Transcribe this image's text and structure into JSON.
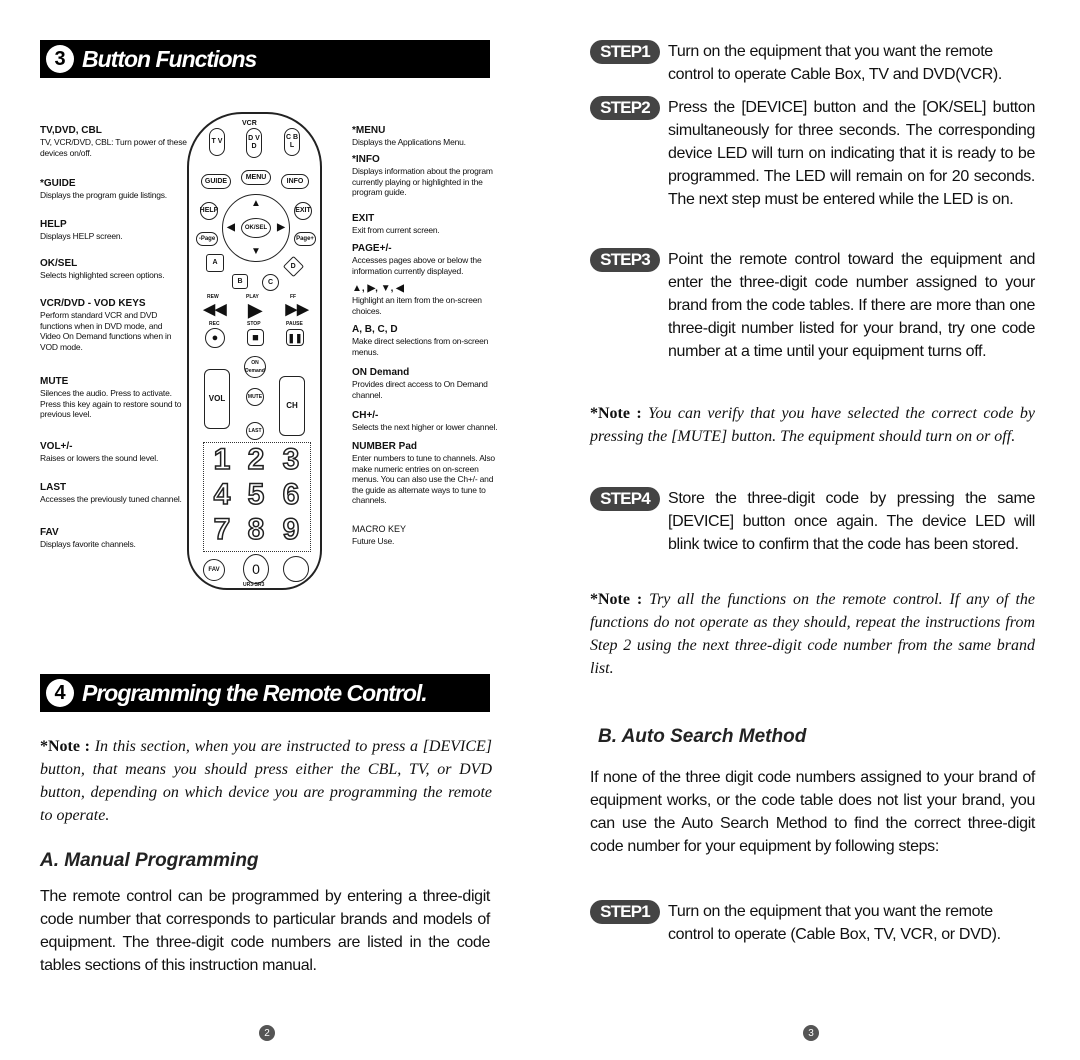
{
  "section3": {
    "number": "3",
    "title": "Button Functions"
  },
  "left_labels": [
    {
      "title": "TV,DVD, CBL",
      "desc": "TV, VCR/DVD, CBL: Turn power of these devices on/off."
    },
    {
      "title": "*GUIDE",
      "desc": "Displays the program guide listings."
    },
    {
      "title": "HELP",
      "desc": "Displays HELP screen."
    },
    {
      "title": "OK/SEL",
      "desc": "Selects highlighted screen options."
    },
    {
      "title": "VCR/DVD - VOD KEYS",
      "desc": "Perform standard VCR and DVD functions when in DVD mode, and Video On Demand functions when in VOD mode."
    },
    {
      "title": "MUTE",
      "desc": "Silences the audio. Press to activate. Press this key again to restore sound to previous level."
    },
    {
      "title": "VOL+/-",
      "desc": "Raises or lowers the sound level."
    },
    {
      "title": "LAST",
      "desc": "Accesses the previously tuned channel."
    },
    {
      "title": "FAV",
      "desc": "Displays favorite channels."
    }
  ],
  "right_labels": [
    {
      "title": "*MENU",
      "desc": "Displays the Applications Menu."
    },
    {
      "title": "*INFO",
      "desc": "Displays information about the program currently playing or highlighted in the program guide."
    },
    {
      "title": "EXIT",
      "desc": "Exit from current screen."
    },
    {
      "title": "PAGE+/-",
      "desc": "Accesses pages above or below the information currently displayed."
    },
    {
      "title": "▲, ▶, ▼, ◀",
      "desc": "Highlight an item from the on-screen choices."
    },
    {
      "title": "A, B, C, D",
      "desc": "Make direct selections from on-screen menus."
    },
    {
      "title": "ON Demand",
      "desc": "Provides direct access to On Demand channel."
    },
    {
      "title": "CH+/-",
      "desc": "Selects the next higher or lower channel."
    },
    {
      "title": "NUMBER Pad",
      "desc": "Enter numbers to tune to channels. Also make numeric entries on on-screen menus. You can also use the Ch+/- and the guide as alternate ways to tune to channels."
    },
    {
      "title": "MACRO KEY",
      "desc": "Future Use."
    }
  ],
  "remote": {
    "vcr": "VCR",
    "tv": "T V",
    "dvd": "D V D",
    "cbl": "C B L",
    "guide": "GUIDE",
    "menu": "MENU",
    "info": "INFO",
    "help": "HELP",
    "exit": "EXIT",
    "ok": "OK/SEL",
    "page_minus": "-Page",
    "page_plus": "Page+",
    "a": "A",
    "b": "B",
    "c": "C",
    "d": "D",
    "rew": "REW",
    "play": "PLAY",
    "ff": "FF",
    "rec": "REC",
    "stop": "STOP",
    "pause": "PAUSE",
    "on_demand": "ON Demand",
    "vol": "VOL",
    "mute": "MUTE",
    "ch": "CH",
    "last": "LAST",
    "fav": "FAV",
    "digits": [
      "1",
      "2",
      "3",
      "4",
      "5",
      "6",
      "7",
      "8",
      "9",
      "0"
    ],
    "model": "UR3-SR3"
  },
  "section4": {
    "number": "4",
    "title": "Programming the Remote Control."
  },
  "note_device": {
    "lead": "*Note :",
    "text": "In this section, when you are instructed to press a [DEVICE] button, that means you should press either the CBL, TV, or DVD button, depending on which device you are programming the remote to operate."
  },
  "manual": {
    "title": "A. Manual Programming",
    "text": "The remote control can be programmed by entering a three-digit code number that corresponds to particular brands and models of equipment. The three-digit code numbers are listed in the code tables sections of this instruction manual."
  },
  "steps": [
    {
      "badge": "STEP1",
      "text": "Turn on the equipment that you want the remote control to operate Cable Box, TV and DVD(VCR)."
    },
    {
      "badge": "STEP2",
      "text": "Press the [DEVICE] button and the [OK/SEL] button simultaneously for three seconds. The corresponding device LED will turn on indicating that it is ready to be programmed. The LED will remain on for 20 seconds. The next step must be entered while the LED is on."
    },
    {
      "badge": "STEP3",
      "text": "Point the remote control toward the equipment and enter the three-digit code number assigned to your brand from the code tables. If there are more than one three-digit number listed for your brand, try one code number at a time until your equipment turns off."
    },
    {
      "badge": "STEP4",
      "text": "Store the three-digit code by pressing the same [DEVICE] button once again. The device LED will blink twice to confirm that the code has been stored."
    }
  ],
  "note_mute": {
    "lead": "*Note :",
    "text": "You can verify that you have selected the correct code by pressing the [MUTE] button. The equipment should turn on or off."
  },
  "note_try": {
    "lead": "*Note :",
    "text": "Try all the functions on the remote control. If any of the functions do not operate as they should, repeat the instructions from Step 2 using the next three-digit code number from the same brand list."
  },
  "auto": {
    "title": "B. Auto Search Method",
    "text": "If none of the three digit code numbers assigned to your brand of equipment works, or the code table does not list your brand, you can use the Auto Search Method to find the correct three-digit code number for your equipment by following steps:",
    "step1_badge": "STEP1",
    "step1_text": "Turn on the equipment that you want the remote control to operate (Cable Box, TV, VCR, or DVD)."
  },
  "page_numbers": [
    "2",
    "3"
  ]
}
